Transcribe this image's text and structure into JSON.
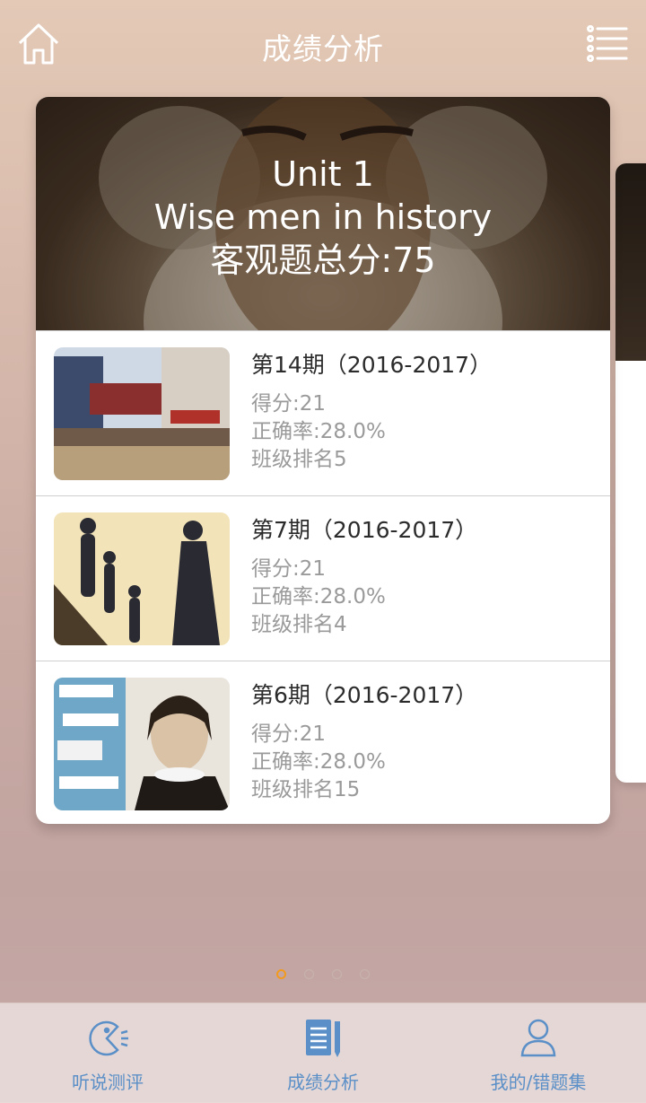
{
  "header": {
    "title": "成绩分析",
    "home_icon": "home-icon",
    "menu_icon": "list-menu-icon"
  },
  "unit": {
    "line1": "Unit 1",
    "line2": "Wise men in history",
    "line3": "客观题总分:75"
  },
  "records": [
    {
      "issue": "第14期（2016-2017）",
      "score": "得分:21",
      "accuracy": "正确率:28.0%",
      "rank": "班级排名5",
      "thumb": "city-street-image"
    },
    {
      "issue": "第7期（2016-2017）",
      "score": "得分:21",
      "accuracy": "正确率:28.0%",
      "rank": "班级排名4",
      "thumb": "family-shadow-image"
    },
    {
      "issue": "第6期（2016-2017）",
      "score": "得分:21",
      "accuracy": "正确率:28.0%",
      "rank": "班级排名15",
      "thumb": "shakespeare-collage-image"
    }
  ],
  "pager": {
    "count": 4,
    "active": 0,
    "active_color": "#f29a1d"
  },
  "tabs": [
    {
      "label": "听说测评",
      "icon": "listen-speak-icon"
    },
    {
      "label": "成绩分析",
      "icon": "report-icon"
    },
    {
      "label": "我的/错题集",
      "icon": "user-icon"
    }
  ],
  "colors": {
    "tab_accent": "#5a8fc7"
  }
}
